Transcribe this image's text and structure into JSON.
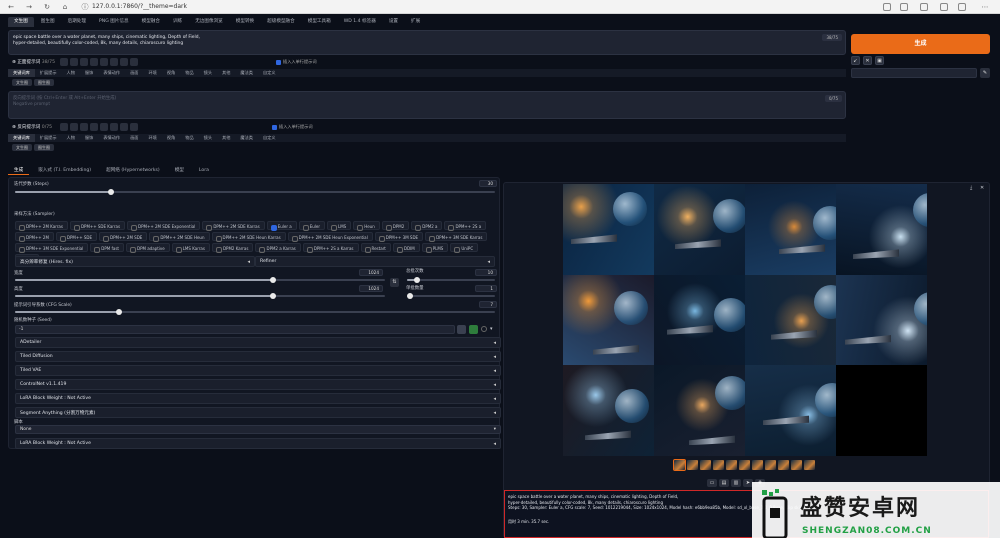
{
  "browser": {
    "url": "127.0.0.1:7860/?__theme=dark"
  },
  "top_tabs": [
    "文生图",
    "图生图",
    "后期处理",
    "PNG 图片信息",
    "模型融合",
    "训练",
    "无边图像浏览",
    "模型转换",
    "超级模型融合",
    "模型工具箱",
    "WD 1.4 标签器",
    "设置",
    "扩展"
  ],
  "prompt": {
    "text": "epic space battle over a water planet, many ships, cinematic lighting, Depth of Field,\nhyper-detailed, beautifully color-coded, 8k, many details, chiaroscuro lighting",
    "token_count": "38/75"
  },
  "negative_prompt": {
    "placeholder": "反向提示词 (按 Ctrl+Enter 或 Alt+Enter 开始生成)\nNegative prompt",
    "token_count": "0/75"
  },
  "generate_button": "生成",
  "positive_network": {
    "title": "正面提示词",
    "count": "38/75",
    "toggle_label": "插入入单行提示词"
  },
  "negative_network": {
    "title": "反向提示词",
    "count": "0/75",
    "toggle_label": "插入入单行提示词"
  },
  "network_tabs": [
    "关键词库",
    "扩展提示",
    "人物",
    "服饰",
    "表情动作",
    "画面",
    "环境",
    "视角",
    "物品",
    "镜头",
    "其他",
    "魔法类",
    "自定义"
  ],
  "network_buttons": [
    "文生图",
    "图生图"
  ],
  "mode_tabs": [
    "生成",
    "嵌入式 (T.I. Embedding)",
    "超网络 (Hypernetworks)",
    "模型",
    "Lora"
  ],
  "settings": {
    "steps_label": "迭代步数 (Steps)",
    "steps_value": "30",
    "steps_fraction": 0.2,
    "sampler_label": "采样方法 (Sampler)",
    "samplers": [
      "DPM++ 2M Karras",
      "DPM++ SDE Karras",
      "DPM++ 2M SDE Exponential",
      "DPM++ 2M SDE Karras",
      "Euler a",
      "Euler",
      "LMS",
      "Heun",
      "DPM2",
      "DPM2 a",
      "DPM++ 2S a",
      "DPM++ 2M",
      "DPM++ SDE",
      "DPM++ 2M SDE",
      "DPM++ 2M SDE Heun",
      "DPM++ 2M SDE Heun Karras",
      "DPM++ 2M SDE Heun Exponential",
      "DPM++ 3M SDE",
      "DPM++ 3M SDE Karras",
      "DPM++ 3M SDE Exponential",
      "DPM fast",
      "DPM adaptive",
      "LMS Karras",
      "DPM2 Karras",
      "DPM2 a Karras",
      "DPM++ 2S a Karras",
      "Restart",
      "DDIM",
      "PLMS",
      "UniPC",
      "LCM"
    ],
    "selected_sampler": "Euler a",
    "hires_label": "高分辨率修复 (Hires. fix)",
    "refiner_label": "Refiner",
    "width_label": "宽度",
    "width_value": "1024",
    "height_label": "高度",
    "height_value": "1024",
    "batch_count_label": "总批次数",
    "batch_count_value": "10",
    "batch_size_label": "单批数量",
    "batch_size_value": "1",
    "cfg_label": "提示词引导系数 (CFG Scale)",
    "cfg_value": "7",
    "seed_label": "随机数种子 (Seed)",
    "seed_value": "-1",
    "accordions": [
      "ADetailer",
      "Tiled Diffusion",
      "Tiled VAE",
      "ControlNet v1.1.419",
      "LoRA Block Weight : Not Active",
      "Segment Anything (分割万物元素)"
    ],
    "script_label": "脚本",
    "script_value": "None",
    "lora_bottom": "LoRA Block Weight : Not Active"
  },
  "output": {
    "info_lines": [
      "epic space battle over a water planet, many ships, cinematic lighting, Depth of Field,",
      "hyper-detailed, beautifully color-coded, 8k, many details, chiaroscuro lighting",
      "Steps: 30, Sampler: Euler a, CFG scale: 7, Seed: 1012219044, Size: 1024x1024, Model hash: e6bb9ea85b, Model: sd_xl_base_1.0_0.9vae, Clip skip: 2"
    ],
    "time_taken": "用时 3 min. 35.7 sec."
  },
  "colors": {
    "accent": "#ea6b18",
    "background": "#0b0f19",
    "info_border": "#d02828"
  },
  "watermark": {
    "cn": "盛赞安卓网",
    "en": "SHENGZAN08.COM.CN"
  }
}
